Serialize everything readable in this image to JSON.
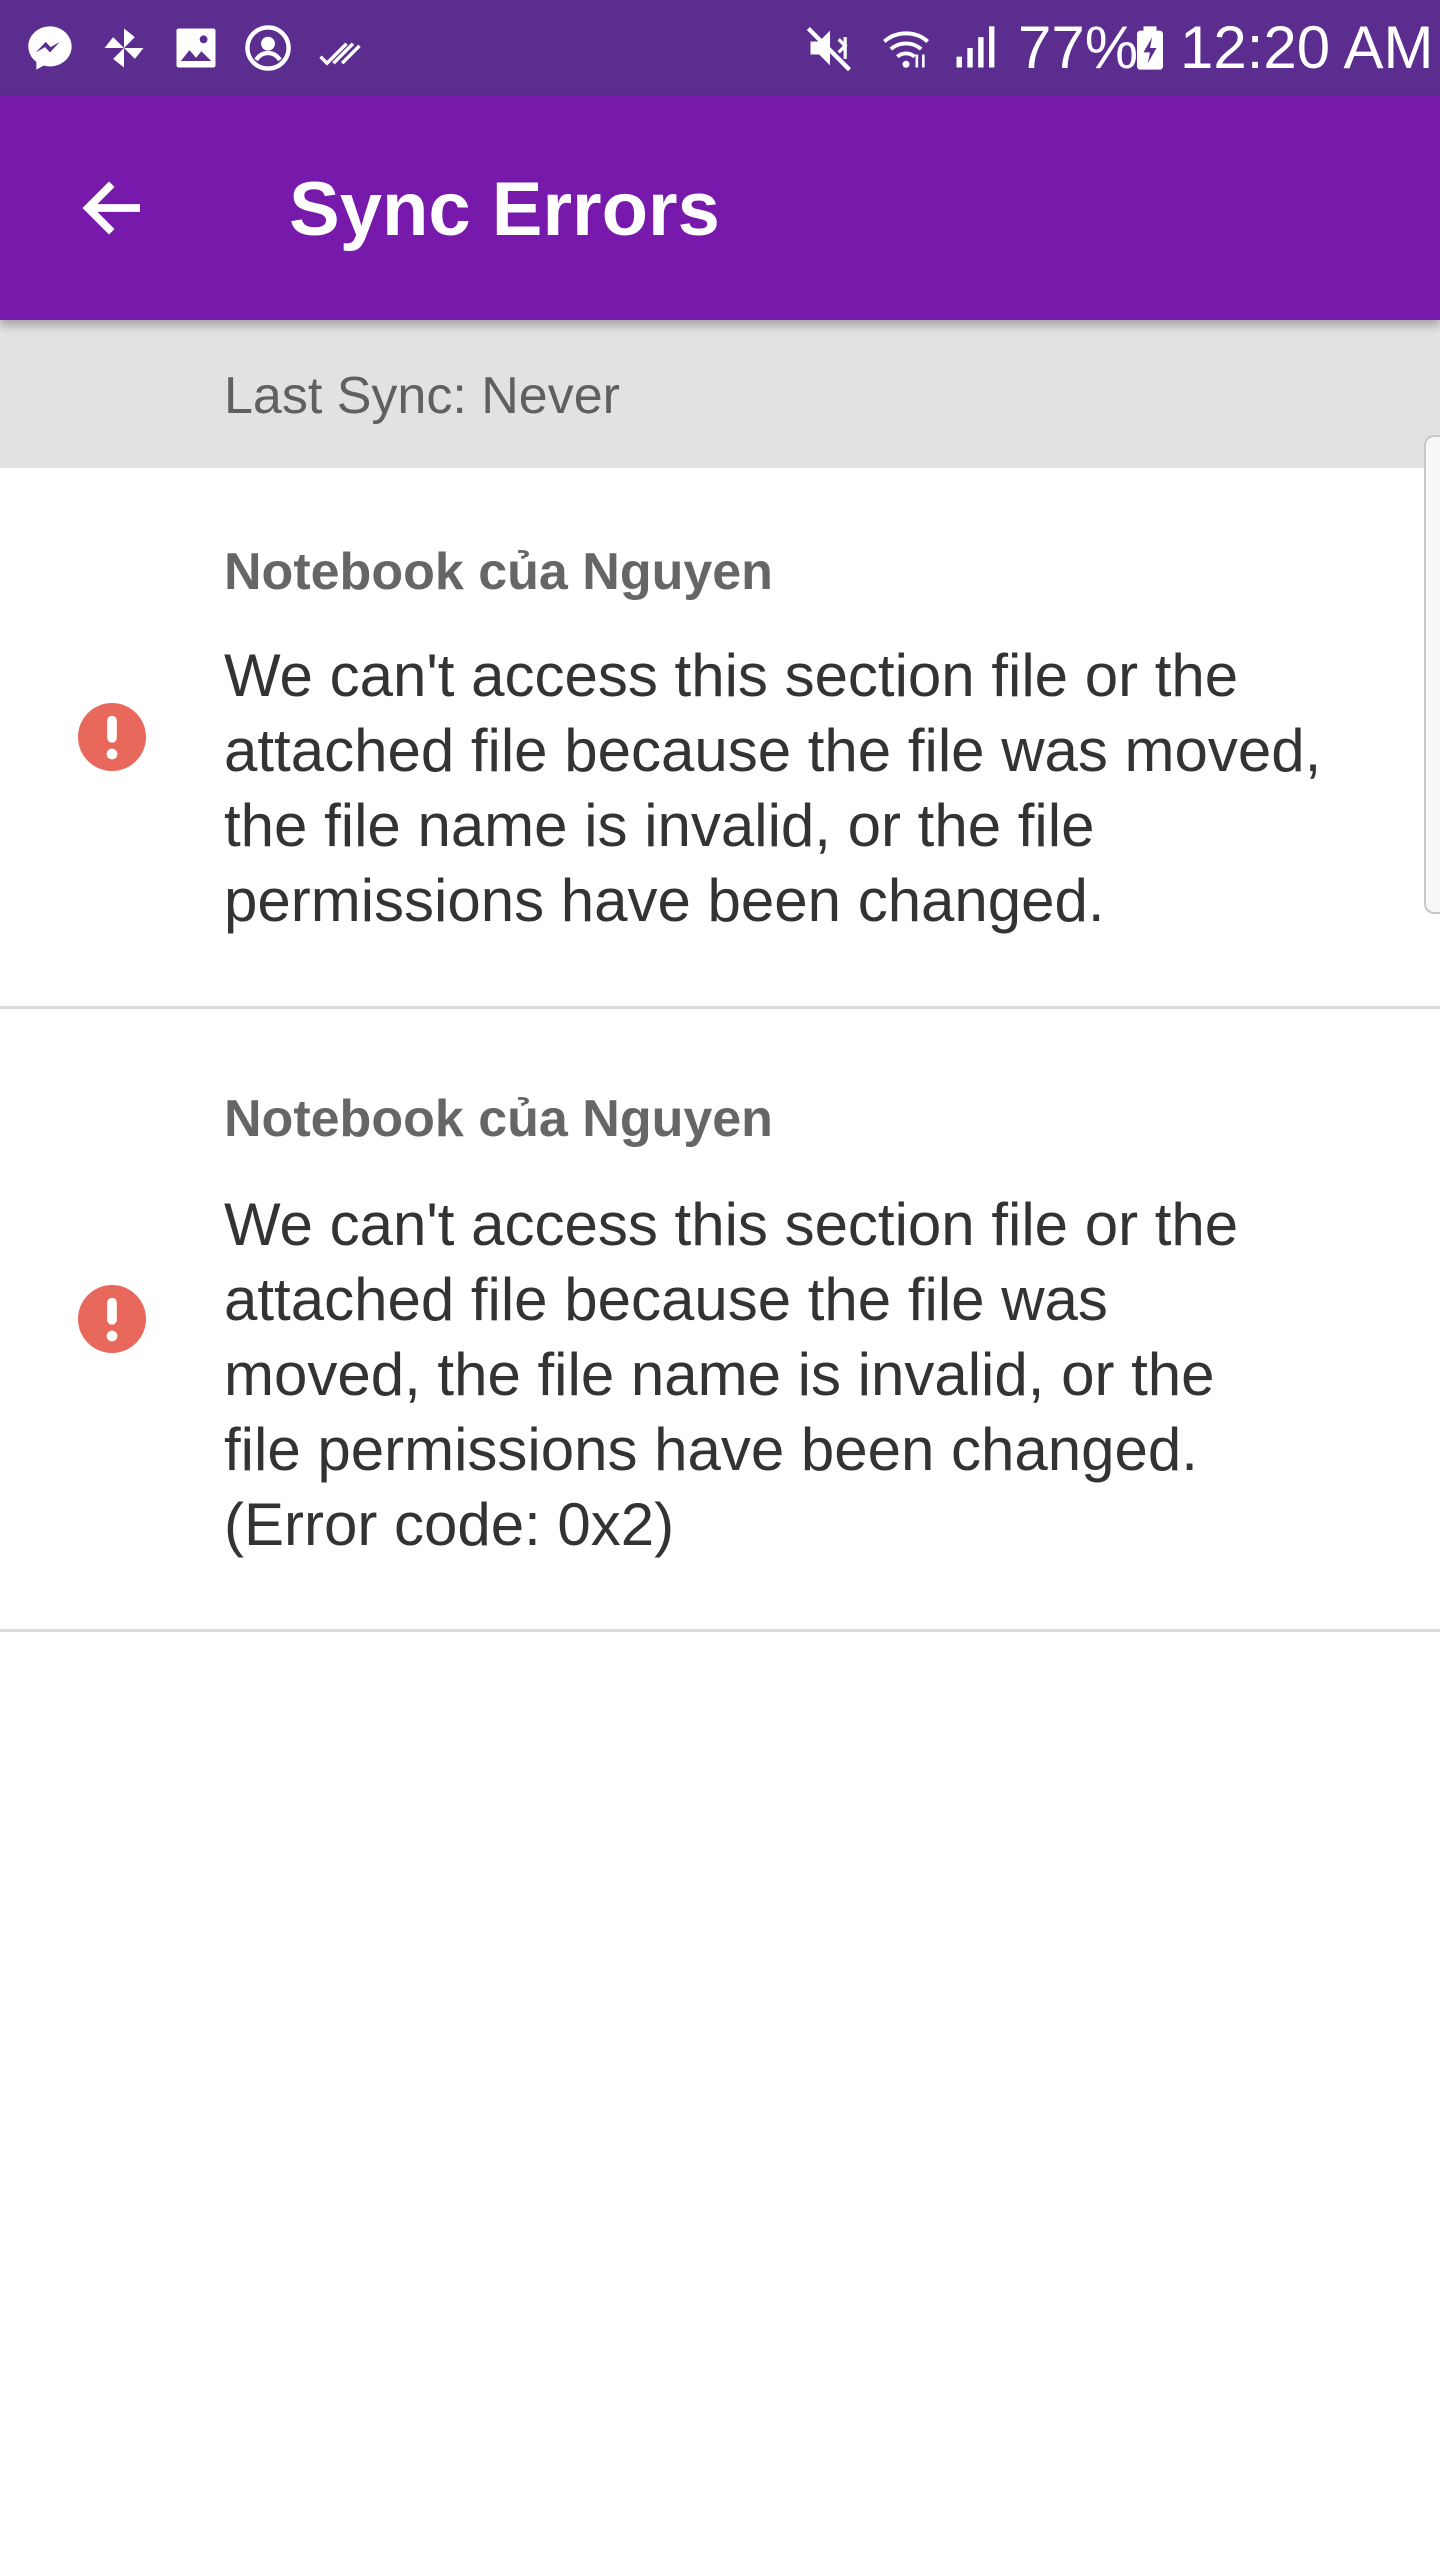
{
  "status_bar": {
    "left_icons": [
      "messenger-icon",
      "pinwheel-icon",
      "gallery-icon",
      "account-icon",
      "checkmarks-icon"
    ],
    "right_icons": [
      "mute-icon",
      "wifi-icon",
      "signal-icon",
      "battery-icon"
    ],
    "battery": "77%",
    "time": "12:20 AM"
  },
  "app_bar": {
    "title": "Sync Errors",
    "back_icon": "back-arrow-icon"
  },
  "last_sync": {
    "text": "Last Sync: Never"
  },
  "errors": [
    {
      "notebook": "Notebook của Nguyen",
      "message": "We can't access this section file or the attached file because the file was moved, the file name is invalid, or the file permissions have been changed.",
      "icon": "error-icon"
    },
    {
      "notebook": "Notebook của Nguyen",
      "message": "We can't access this section file or the attached file because the file was moved, the file name is invalid, or the file permissions have been changed. (Error code: 0x2)",
      "icon": "error-icon"
    }
  ],
  "colors": {
    "status_bar": "#5b2d8f",
    "app_bar": "#7719aa",
    "error_icon": "#e8685c",
    "last_sync_bg": "#e2e2e2"
  }
}
